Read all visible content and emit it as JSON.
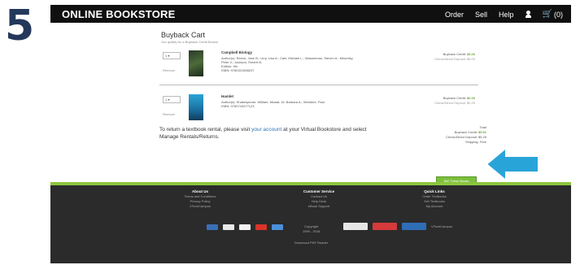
{
  "step": "5",
  "header": {
    "brand": "ONLINE BOOKSTORE",
    "nav": [
      "Order",
      "Sell",
      "Help"
    ],
    "cart_count": "(0)"
  },
  "cart": {
    "title": "Buyback Cart",
    "subtitle": "You qualify for a Buyback Credit Bonus!",
    "items": [
      {
        "qty": "1",
        "remove": "Remove",
        "title": "Campbell Biology",
        "authors": "Author(s): Reece, Jane B.; Urry, Lisa A.; Cain, Michael L.; Wasserman, Steven A.; Minorsky, Peter V.; Jackson, Robert B.",
        "edition": "Edition: 9th",
        "isbn": "ISBN: 9780321558237",
        "credit_label": "Buyback Credit:",
        "credit_value": "$5.26",
        "deposit_label": "Check/Direct Deposit:",
        "deposit_value": "$5.00"
      },
      {
        "qty": "1",
        "remove": "Remove",
        "title": "Hamlet",
        "authors": "Author(s): Shakespeare, William; Mowat, Dr. Barbara A.; Werstine, Paul",
        "edition": "",
        "isbn": "ISBN: 9780743477123",
        "credit_label": "Buyback Credit:",
        "credit_value": "$0.26",
        "deposit_label": "Check/Direct Deposit:",
        "deposit_value": "$0.25"
      }
    ],
    "return_note_pre": "To return a textbook rental, please visit ",
    "return_note_link": "your account",
    "return_note_post": " at your Virtual Bookstore and select Manage Rentals/Returns.",
    "totals": {
      "total_label": "Total",
      "credit_label": "Buyback Credit:",
      "credit_value": "$5.51",
      "deposit_label": "Check/Direct Deposit:",
      "deposit_value": "$5.25",
      "shipping_label": "Shipping:",
      "shipping_value": "Free"
    },
    "sell_button": "Sell These Books"
  },
  "footer": {
    "columns": [
      {
        "heading": "About Us",
        "links": [
          "Terms and Conditions",
          "Privacy Policy",
          "VTechCampus"
        ]
      },
      {
        "heading": "Customer Service",
        "links": [
          "Contact Us",
          "Help Desk",
          "eBook Support"
        ]
      },
      {
        "heading": "Quick Links",
        "links": [
          "Order Textbooks",
          "Sell Textbooks",
          "My Account"
        ]
      }
    ],
    "copyright_1": "Copyright",
    "copyright_2": "1999 - 2018",
    "partner": "VTechCampus",
    "download": "Download PDF Reader"
  },
  "colors": {
    "accent_green": "#7cbf3c",
    "arrow_blue": "#29a4d8",
    "step_color": "#24385b",
    "link_blue": "#2a74b8"
  }
}
